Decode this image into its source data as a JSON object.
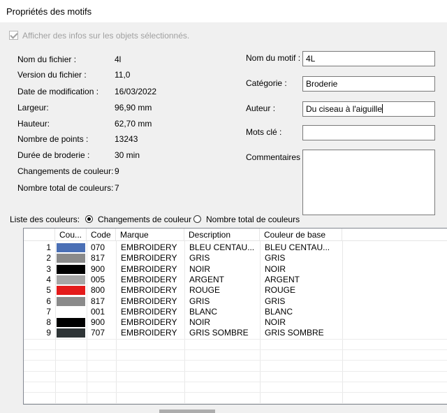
{
  "window": {
    "title": "Propriétés des motifs"
  },
  "show_info": {
    "label": "Afficher des infos sur les objets sélectionnés.",
    "checked": true
  },
  "info": [
    {
      "label": "Nom du fichier :",
      "value": "4l"
    },
    {
      "label": "Version du fichier :",
      "value": "11,0"
    },
    {
      "label": "Date de modification :",
      "value": "16/03/2022"
    },
    {
      "label": "Largeur:",
      "value": "96,90 mm"
    },
    {
      "label": "Hauteur:",
      "value": "62,70 mm"
    },
    {
      "label": "Nombre de points :",
      "value": "13243"
    },
    {
      "label": "Durée de broderie :",
      "value": "30 min"
    },
    {
      "label": "Changements de couleur:",
      "value": "9"
    },
    {
      "label": "Nombre total de couleurs:",
      "value": "7"
    }
  ],
  "fields": {
    "nom_label": "Nom du motif :",
    "nom_value": "4L",
    "categorie_label": "Catégorie :",
    "categorie_value": "Broderie",
    "auteur_label": "Auteur :",
    "auteur_value": "Du ciseau à l'aiguille",
    "mots_label": "Mots clé :",
    "mots_value": "",
    "commentaires_label": "Commentaires :"
  },
  "color_list": {
    "label": "Liste des couleurs:",
    "option_changes": "Changements de couleur",
    "option_total": "Nombre total de couleurs",
    "selected": "changes",
    "columns": [
      "Cou...",
      "Code",
      "Marque",
      "Description",
      "Couleur de base"
    ],
    "rows": [
      {
        "num": "1",
        "color": "#4a6fb5",
        "code": "070",
        "marque": "EMBROIDERY",
        "description": "BLEU CENTAU...",
        "base": "BLEU CENTAU..."
      },
      {
        "num": "2",
        "color": "#8a8a8a",
        "code": "817",
        "marque": "EMBROIDERY",
        "description": "GRIS",
        "base": "GRIS"
      },
      {
        "num": "3",
        "color": "#000000",
        "code": "900",
        "marque": "EMBROIDERY",
        "description": "NOIR",
        "base": "NOIR"
      },
      {
        "num": "4",
        "color": "#a6a6a6",
        "code": "005",
        "marque": "EMBROIDERY",
        "description": "ARGENT",
        "base": "ARGENT"
      },
      {
        "num": "5",
        "color": "#e41b1b",
        "code": "800",
        "marque": "EMBROIDERY",
        "description": "ROUGE",
        "base": "ROUGE"
      },
      {
        "num": "6",
        "color": "#8a8a8a",
        "code": "817",
        "marque": "EMBROIDERY",
        "description": "GRIS",
        "base": "GRIS"
      },
      {
        "num": "7",
        "color": "#ffffff",
        "code": "001",
        "marque": "EMBROIDERY",
        "description": "BLANC",
        "base": "BLANC"
      },
      {
        "num": "8",
        "color": "#000000",
        "code": "900",
        "marque": "EMBROIDERY",
        "description": "NOIR",
        "base": "NOIR"
      },
      {
        "num": "9",
        "color": "#2e3436",
        "code": "707",
        "marque": "EMBROIDERY",
        "description": "GRIS SOMBRE",
        "base": "GRIS SOMBRE"
      }
    ]
  }
}
